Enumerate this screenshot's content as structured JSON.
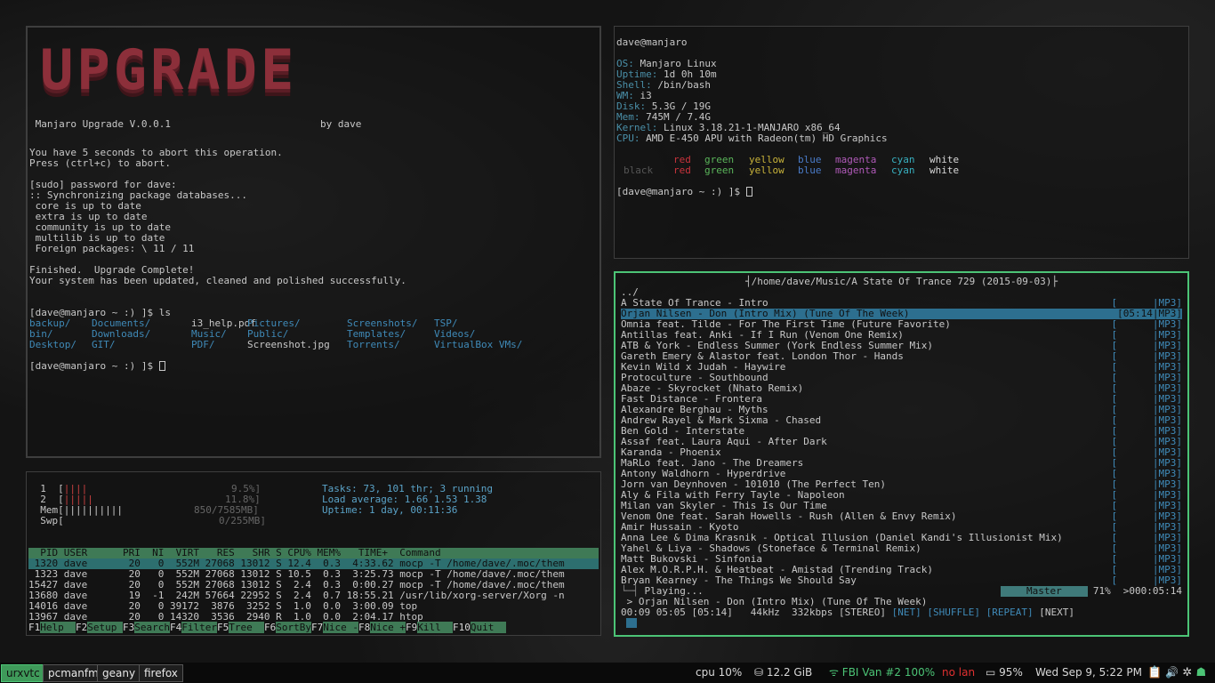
{
  "upgrade": {
    "logo": "UPGRADE",
    "banner_left": " Manjaro Upgrade V.0.0.1",
    "banner_right": "by dave",
    "lines": [
      "You have 5 seconds to abort this operation.",
      "Press (ctrl+c) to abort.",
      "",
      "[sudo] password for dave:",
      ":: Synchronizing package databases...",
      " core is up to date",
      " extra is up to date",
      " community is up to date",
      " multilib is up to date",
      " Foreign packages: \\ 11 / 11",
      "",
      "Finished.  Upgrade Complete!",
      "Your system has been updated, cleaned and polished successfully.",
      "",
      ""
    ],
    "prompt1": "[dave@manjaro ~ :) ]$ ls",
    "ls_rows": [
      [
        "backup/",
        "Documents/",
        "i3_help.pdf",
        "Pictures/",
        "Screenshots/",
        "TSP/"
      ],
      [
        "bin/",
        "Downloads/",
        "Music/",
        "Public/",
        "Templates/",
        "Videos/"
      ],
      [
        "Desktop/",
        "GIT/",
        "PDF/",
        "Screenshot.jpg",
        "Torrents/",
        "VirtualBox VMs/"
      ]
    ],
    "prompt2": "[dave@manjaro ~ :) ]$ "
  },
  "info": {
    "user": "dave@manjaro",
    "rows": [
      {
        "label": "OS:",
        "value": " Manjaro Linux"
      },
      {
        "label": "Uptime:",
        "value": " 1d 0h 10m"
      },
      {
        "label": "Shell:",
        "value": " /bin/bash"
      },
      {
        "label": "WM:",
        "value": " i3"
      },
      {
        "label": "Disk:",
        "value": " 5.3G / 19G"
      },
      {
        "label": "Mem:",
        "value": " 745M / 7.4G"
      },
      {
        "label": "Kernel:",
        "value": " Linux 3.18.21-1-MANJARO x86_64"
      },
      {
        "label": "CPU:",
        "value": " AMD E-450 APU with Radeon(tm) HD Graphics"
      }
    ],
    "colors1": [
      "",
      "red",
      "green",
      "yellow",
      "blue",
      "magenta",
      "cyan",
      "white"
    ],
    "colors2": [
      "black",
      "red",
      "green",
      "yellow",
      "blue",
      "magenta",
      "cyan",
      "white"
    ],
    "prompt": "[dave@manjaro ~ :) ]$ "
  },
  "htop": {
    "cpu1_label": "  1  [",
    "cpu1_bar": "||||",
    "cpu1_val": "9.5%]",
    "cpu2_label": "  2  [",
    "cpu2_bar": "|||||",
    "cpu2_val": "11.8%]",
    "mem_label": "  Mem[",
    "mem_bar": "||||||||||",
    "mem_val": "850/7585MB]",
    "swp_label": "  Swp[",
    "swp_val": "0/255MB]",
    "tasks": "Tasks: 73, 101 thr; 3 running",
    "load": "Load average: 1.66 1.53 1.38",
    "uptime": "Uptime: 1 day, 00:11:36",
    "header": "  PID USER      PRI  NI  VIRT   RES   SHR S CPU% MEM%   TIME+  Command",
    "rows": [
      " 1320 dave       20   0  552M 27068 13012 S 12.4  0.3  4:33.62 mocp -T /home/dave/.moc/them",
      " 1323 dave       20   0  552M 27068 13012 S 10.5  0.3  3:25.73 mocp -T /home/dave/.moc/them",
      "15427 dave       20   0  552M 27068 13012 S  2.4  0.3  0:00.27 mocp -T /home/dave/.moc/them",
      "13680 dave       19  -1  242M 57664 22952 S  2.4  0.7 18:55.21 /usr/lib/xorg-server/Xorg -n",
      "14016 dave       20   0 39172  3876  3252 S  1.0  0.0  3:00.09 top",
      "13967 dave       20   0 14320  3536  2940 R  1.0  0.0  2:04.17 htop"
    ],
    "fkeys": [
      {
        "k": "F1",
        "v": "Help  "
      },
      {
        "k": "F2",
        "v": "Setup "
      },
      {
        "k": "F3",
        "v": "Search"
      },
      {
        "k": "F4",
        "v": "Filter"
      },
      {
        "k": "F5",
        "v": "Tree  "
      },
      {
        "k": "F6",
        "v": "SortBy"
      },
      {
        "k": "F7",
        "v": "Nice -"
      },
      {
        "k": "F8",
        "v": "Nice +"
      },
      {
        "k": "F9",
        "v": "Kill  "
      },
      {
        "k": "F10",
        "v": "Quit  "
      }
    ]
  },
  "moc": {
    "path": "/home/dave/Music/A State Of Trance 729 (2015-09-03)",
    "updir": "../",
    "tracks": [
      {
        "t": "A State Of Trance - Intro",
        "d": "[      |MP3]"
      },
      {
        "t": "Orjan Nilsen - Don (Intro Mix) (Tune Of The Week)",
        "d": "[05:14|MP3]"
      },
      {
        "t": "Omnia feat. Tilde - For The First Time (Future Favorite)",
        "d": "[      |MP3]"
      },
      {
        "t": "Antillas feat. Anki - If I Run (Venom One Remix)",
        "d": "[      |MP3]"
      },
      {
        "t": "ATB & York - Endless Summer (York Endless Summer Mix)",
        "d": "[      |MP3]"
      },
      {
        "t": "Gareth Emery & Alastor feat. London Thor - Hands",
        "d": "[      |MP3]"
      },
      {
        "t": "Kevin Wild x Judah - Haywire",
        "d": "[      |MP3]"
      },
      {
        "t": "Protoculture - Southbound",
        "d": "[      |MP3]"
      },
      {
        "t": "Abaze - Skyrocket (Nhato Remix)",
        "d": "[      |MP3]"
      },
      {
        "t": "Fast Distance - Frontera",
        "d": "[      |MP3]"
      },
      {
        "t": "Alexandre Berghau - Myths",
        "d": "[      |MP3]"
      },
      {
        "t": "Andrew Rayel & Mark Sixma - Chased",
        "d": "[      |MP3]"
      },
      {
        "t": "Ben Gold - Interstate",
        "d": "[      |MP3]"
      },
      {
        "t": "Assaf feat. Laura Aqui - After Dark",
        "d": "[      |MP3]"
      },
      {
        "t": "Karanda - Phoenix",
        "d": "[      |MP3]"
      },
      {
        "t": "MaRLo feat. Jano - The Dreamers",
        "d": "[      |MP3]"
      },
      {
        "t": "Antony Waldhorn - Hyperdrive",
        "d": "[      |MP3]"
      },
      {
        "t": "Jorn van Deynhoven - 101010 (The Perfect Ten)",
        "d": "[      |MP3]"
      },
      {
        "t": "Aly & Fila with Ferry Tayle - Napoleon",
        "d": "[      |MP3]"
      },
      {
        "t": "Milan van Skyler - This Is Our Time",
        "d": "[      |MP3]"
      },
      {
        "t": "Venom One feat. Sarah Howells - Rush (Allen & Envy Remix)",
        "d": "[      |MP3]"
      },
      {
        "t": "Amir Hussain - Kyoto",
        "d": "[      |MP3]"
      },
      {
        "t": "Anna Lee & Dima Krasnik - Optical Illusion (Daniel Kandi's Illusionist Mix)",
        "d": "[      |MP3]"
      },
      {
        "t": "Yahel & Liya - Shadows (Stoneface & Terminal Remix)",
        "d": "[      |MP3]"
      },
      {
        "t": "Matt Bukovski - Sinfonia",
        "d": "[      |MP3]"
      },
      {
        "t": "Alex M.O.R.P.H. & Heatbeat - Amistad (Trending Track)",
        "d": "[      |MP3]"
      },
      {
        "t": "Bryan Kearney - The Things We Should Say",
        "d": "[      |MP3]"
      }
    ],
    "state": "Playing...",
    "mixer": "Master",
    "volume": "71%",
    "total": ">000:05:14",
    "now_playing": " > Orjan Nilsen - Don (Intro Mix) (Tune Of The Week)",
    "time_info": "00:09 05:05 [05:14]   44kHz  332kbps [STEREO] ",
    "flags": [
      "[NET]",
      "[SHUFFLE]",
      "[REPEAT]",
      "[NEXT]"
    ]
  },
  "taskbar": {
    "workspaces": [
      "urxvtc",
      "pcmanfm",
      "geany",
      "firefox"
    ],
    "cpu": "cpu  10%",
    "disk": "12.2 GiB",
    "wifi": "FBI Van #2 100%",
    "lan": "no lan",
    "battery": "95%",
    "datetime": "Wed Sep  9, 5:22 PM"
  }
}
